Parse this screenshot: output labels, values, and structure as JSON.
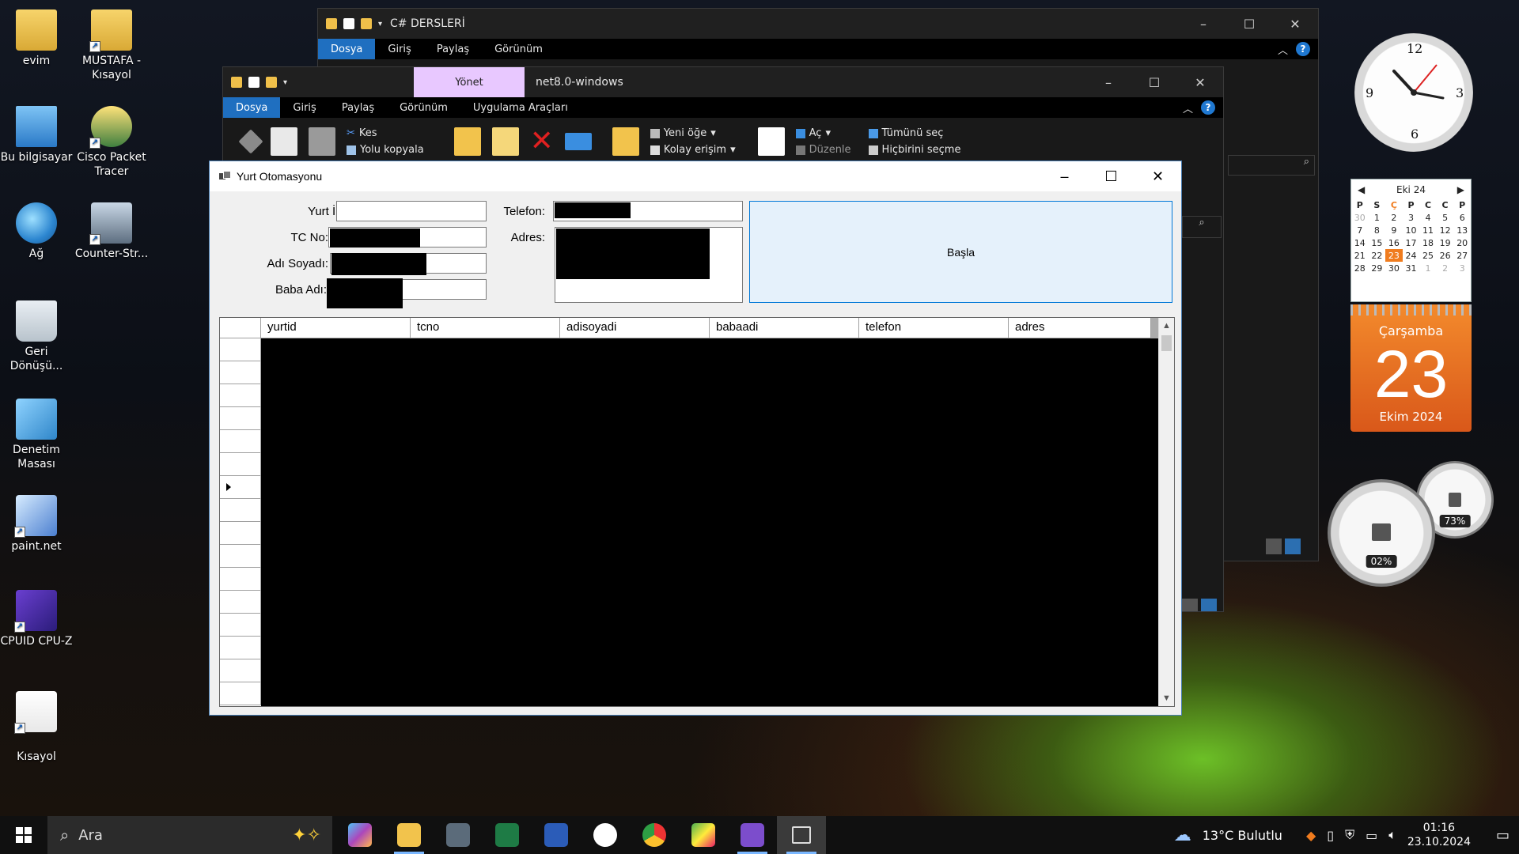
{
  "desktop": {
    "icons": [
      {
        "label": "evim"
      },
      {
        "label": "MUSTAFA - Kısayol"
      },
      {
        "label": "Bu bilgisayar"
      },
      {
        "label": "Cisco Packet Tracer"
      },
      {
        "label": "Ağ"
      },
      {
        "label": "Counter-Str..."
      },
      {
        "label": "Geri Dönüşü..."
      },
      {
        "label": "Denetim Masası"
      },
      {
        "label": "paint.net"
      },
      {
        "label": "CPUID CPU-Z"
      },
      {
        "label": "Kısayol"
      }
    ]
  },
  "explorer_back": {
    "title": "C# DERSLERİ",
    "tabs": [
      "Dosya",
      "Giriş",
      "Paylaş",
      "Görünüm"
    ]
  },
  "explorer_front": {
    "context_tab": "Yönet",
    "title": "net8.0-windows",
    "tabs": [
      "Dosya",
      "Giriş",
      "Paylaş",
      "Görünüm",
      "Uygulama Araçları"
    ],
    "ribbon": {
      "cut": "Kes",
      "copy_path": "Yolu kopyala",
      "new_item": "Yeni öğe",
      "easy_access": "Kolay erişim",
      "open": "Aç",
      "edit": "Düzenle",
      "select_all": "Tümünü seç",
      "select_none": "Hiçbirini seçme"
    }
  },
  "app": {
    "title": "Yurt Otomasyonu",
    "labels": {
      "yurt_id": "Yurt İD",
      "tc_no": "TC No:",
      "adi_soyadi": "Adı Soyadı:",
      "baba_adi": "Baba Adı:",
      "telefon": "Telefon:",
      "adres": "Adres:"
    },
    "start_button": "Başla",
    "grid": {
      "columns": [
        "yurtid",
        "tcno",
        "adisoyadi",
        "babaadi",
        "telefon",
        "adres"
      ]
    }
  },
  "gadgets": {
    "calendar": {
      "month_label": "Eki 24",
      "weekdays": [
        "P",
        "S",
        "Ç",
        "P",
        "C",
        "C",
        "P"
      ],
      "weeks": [
        [
          "30",
          "1",
          "2",
          "3",
          "4",
          "5",
          "6"
        ],
        [
          "7",
          "8",
          "9",
          "10",
          "11",
          "12",
          "13"
        ],
        [
          "14",
          "15",
          "16",
          "17",
          "18",
          "19",
          "20"
        ],
        [
          "21",
          "22",
          "23",
          "24",
          "25",
          "26",
          "27"
        ],
        [
          "28",
          "29",
          "30",
          "31",
          "1",
          "2",
          "3"
        ]
      ],
      "today": "23"
    },
    "date_card": {
      "weekday": "Çarşamba",
      "day": "23",
      "month_year": "Ekim 2024"
    },
    "cpu_gauge": "02%",
    "memory_gauge": "73%"
  },
  "taskbar": {
    "search_placeholder": "Ara",
    "weather": "13°C  Bulutlu",
    "time": "01:16",
    "date": "23.10.2024"
  }
}
